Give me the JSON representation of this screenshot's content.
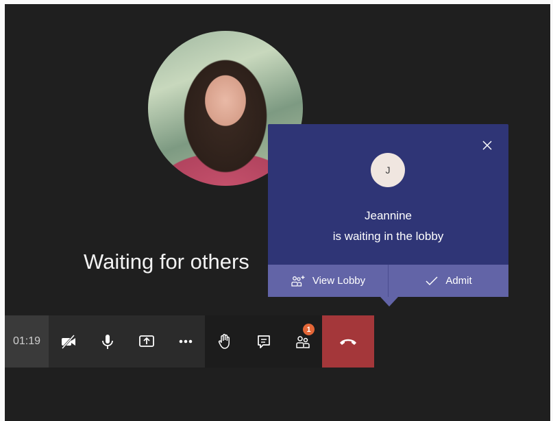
{
  "call": {
    "waiting_text": "Waiting for others",
    "timer": "01:19"
  },
  "toolbar": {
    "buttons": [
      {
        "name": "camera-off-button",
        "icon": "video-off-icon"
      },
      {
        "name": "microphone-button",
        "icon": "microphone-icon"
      },
      {
        "name": "share-screen-button",
        "icon": "share-screen-icon"
      },
      {
        "name": "more-actions-button",
        "icon": "ellipsis-icon"
      },
      {
        "name": "raise-hand-button",
        "icon": "hand-icon"
      },
      {
        "name": "chat-button",
        "icon": "chat-icon"
      },
      {
        "name": "participants-button",
        "icon": "people-icon"
      },
      {
        "name": "hang-up-button",
        "icon": "phone-hangup-icon"
      }
    ],
    "participants_badge": "1"
  },
  "lobby_popup": {
    "avatar_initial": "J",
    "name": "Jeannine",
    "message": "is waiting in the lobby",
    "view_lobby_label": "View Lobby",
    "admit_label": "Admit"
  },
  "colors": {
    "background": "#1f1f1f",
    "popup": "#2f3576",
    "popup_actions": "#6264a7",
    "hangup": "#a4373a",
    "badge": "#e36637"
  }
}
